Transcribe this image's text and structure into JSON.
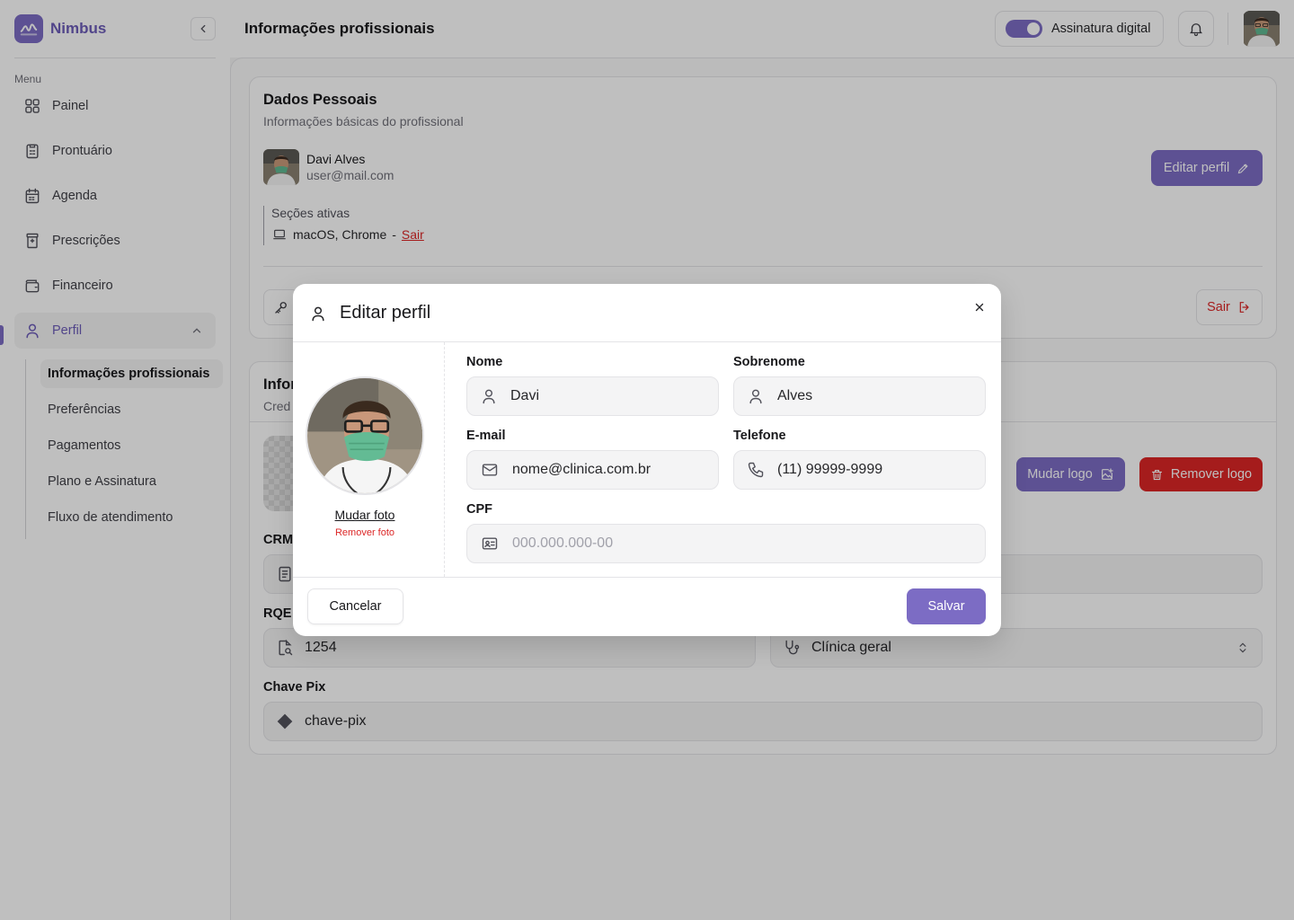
{
  "brand": {
    "name": "Nimbus",
    "accent": "#7c6cc4"
  },
  "sidebar": {
    "menu_label": "Menu",
    "items": [
      {
        "label": "Painel",
        "icon": "grid-icon"
      },
      {
        "label": "Prontuário",
        "icon": "clipboard-icon"
      },
      {
        "label": "Agenda",
        "icon": "calendar-icon"
      },
      {
        "label": "Prescrições",
        "icon": "pill-bottle-icon"
      },
      {
        "label": "Financeiro",
        "icon": "wallet-icon"
      },
      {
        "label": "Perfil",
        "icon": "user-icon",
        "active": true
      }
    ],
    "subitems": [
      {
        "label": "Informações profissionais",
        "active": true
      },
      {
        "label": "Preferências"
      },
      {
        "label": "Pagamentos"
      },
      {
        "label": "Plano e Assinatura"
      },
      {
        "label": "Fluxo de atendimento"
      }
    ]
  },
  "header": {
    "title": "Informações profissionais",
    "digital_signature_label": "Assinatura digital",
    "digital_signature_on": true
  },
  "personal": {
    "title": "Dados Pessoais",
    "subtitle": "Informações básicas do profissional",
    "user_name": "Davi Alves",
    "user_email": "user@mail.com",
    "edit_profile_label": "Editar perfil",
    "sessions_label": "Seções ativas",
    "session_device": "macOS, Chrome",
    "session_separator": "-",
    "session_logout": "Sair",
    "logout_label": "Sair"
  },
  "professional": {
    "title_partial": "Infor",
    "subtitle_partial": "Cred",
    "change_logo_label": "Mudar logo",
    "remove_logo_label": "Remover logo",
    "crm_label_partial": "CRM",
    "rqe_label_partial": "RQE",
    "rqe_value": "1254",
    "specialty_value": "Clínica geral",
    "pix_label": "Chave Pix",
    "pix_value": "chave-pix"
  },
  "modal": {
    "title": "Editar perfil",
    "change_photo": "Mudar foto",
    "remove_photo": "Remover foto",
    "first_name_label": "Nome",
    "first_name_value": "Davi",
    "last_name_label": "Sobrenome",
    "last_name_value": "Alves",
    "email_label": "E-mail",
    "email_value": "nome@clinica.com.br",
    "phone_label": "Telefone",
    "phone_value": "(11) 99999-9999",
    "cpf_label": "CPF",
    "cpf_placeholder": "000.000.000-00",
    "cancel_label": "Cancelar",
    "save_label": "Salvar"
  }
}
